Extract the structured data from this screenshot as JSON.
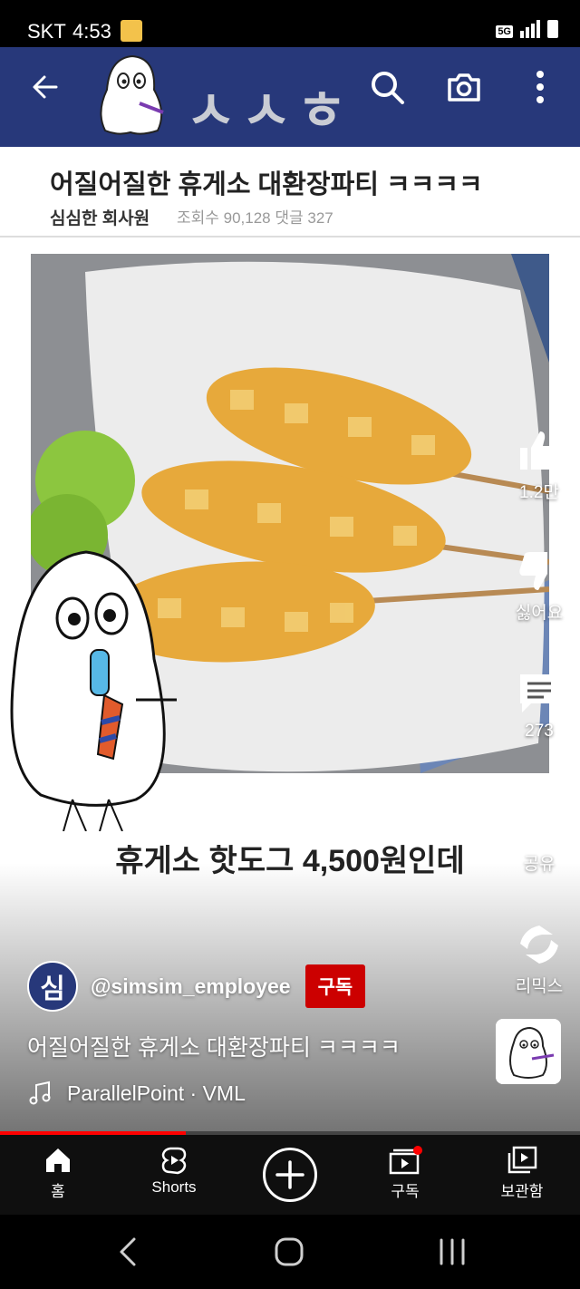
{
  "status_bar": {
    "carrier": "SKT",
    "time": "4:53",
    "network": "5G"
  },
  "video": {
    "top_bar_brand": "ㅅㅅㅎ",
    "post_title": "어질어질한 휴게소 대환장파티 ㅋㅋㅋㅋ",
    "post_author": "심심한 회사원",
    "post_stats": "조회수 90,128   댓글 327",
    "caption": "휴게소 핫도그 4,500원인데"
  },
  "actions": {
    "like_count": "1.2만",
    "dislike_label": "싫어요",
    "comment_count": "273",
    "share_label": "공유",
    "remix_label": "리믹스"
  },
  "channel": {
    "avatar_text": "심",
    "handle": "@simsim_employee",
    "subscribe_label": "구독"
  },
  "short_info": {
    "title": "어질어질한 휴게소 대환장파티 ㅋㅋㅋㅋ",
    "music": "ParallelPoint · VML"
  },
  "playback": {
    "progress_fraction": 0.32
  },
  "bottom_nav": {
    "home": "홈",
    "shorts": "Shorts",
    "subscriptions": "구독",
    "library": "보관함"
  },
  "colors": {
    "brand_navy": "#27387a",
    "subscribe_red": "#cc0000",
    "progress_red": "#ff0000",
    "nav_bg": "#0f0f0f"
  },
  "icons": {
    "back": "arrow-left-icon",
    "search": "search-icon",
    "camera": "camera-icon",
    "more": "more-vert-icon",
    "like": "thumb-up-icon",
    "dislike": "thumb-down-icon",
    "comment": "comment-icon",
    "share": "share-icon",
    "remix": "remix-icon",
    "music": "music-note-icon"
  }
}
